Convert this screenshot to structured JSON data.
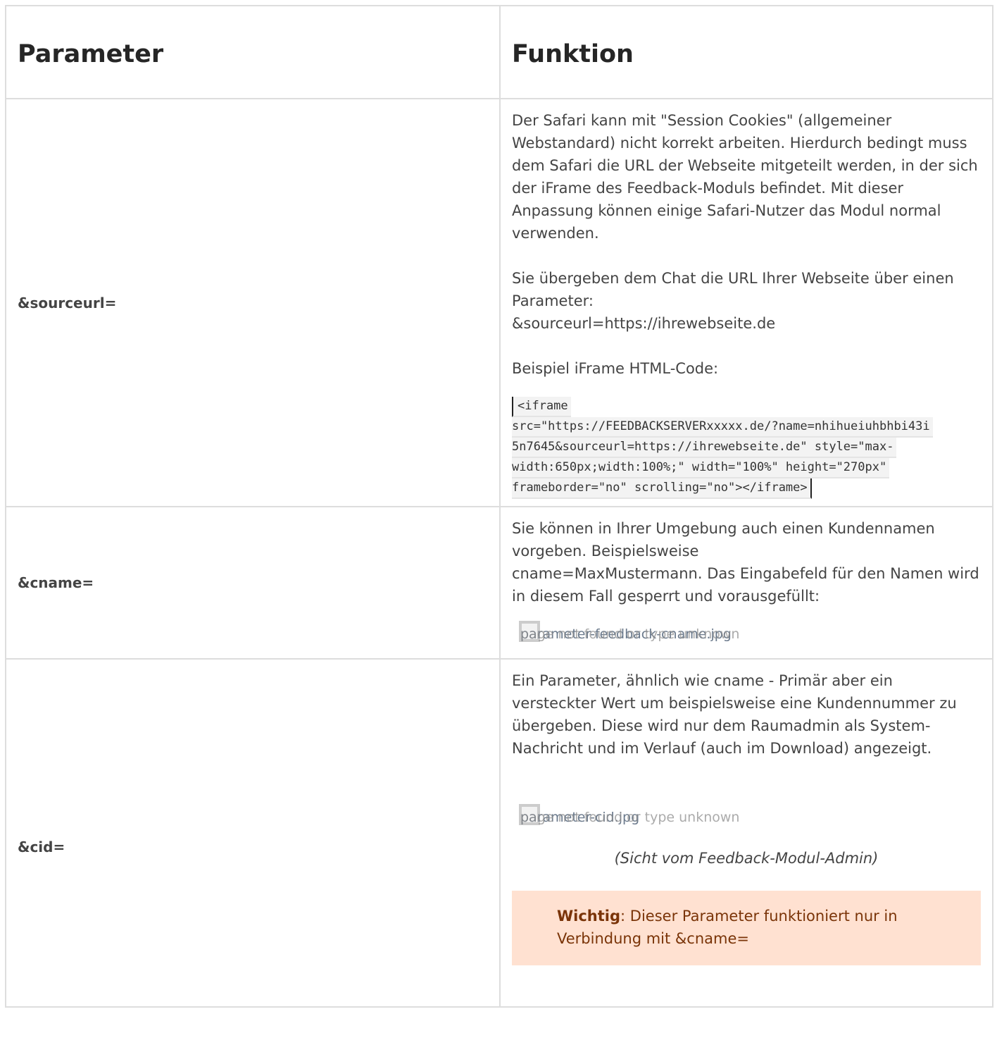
{
  "headers": {
    "parameter": "Parameter",
    "function": "Funktion"
  },
  "rows": [
    {
      "name": "&sourceurl=",
      "para1": "Der Safari kann mit \"Session Cookies\" (allgemeiner Webstandard) nicht korrekt arbeiten. Hierdurch bedingt muss dem Safari die URL der Webseite mitgeteilt werden, in der sich der iFrame des Feedback-Moduls befindet. Mit dieser Anpassung können einige Safari-Nutzer das Modul normal verwenden.",
      "para2_line1": "Sie übergeben dem Chat die URL Ihrer Webseite über einen Parameter:",
      "para2_line2": "&sourceurl=https://ihrewebseite.de",
      "para3": "Beispiel iFrame HTML-Code:",
      "code_lines": [
        "<iframe ",
        "src=\"https://FEEDBACKSERVERxxxxx.de/?name=nhihueiuhbhbi43i",
        "5n7645&sourceurl=https://ihrewebseite.de\" style=\"max-",
        "width:650px;width:100%;\"  width=\"100%\" height=\"270px\"",
        "frameborder=\"no\" scrolling=\"no\"></iframe>"
      ]
    },
    {
      "name": "&cname=",
      "para1": "Sie können in Ihrer Umgebung auch einen Kundennamen vorgeben. Beispielsweise",
      "para2": "cname=MaxMustermann. Das Eingabefeld für den Namen wird in diesem Fall gesperrt und vorausgefüllt:",
      "image_filename": "parameter-feedback-cname.jpg",
      "image_error": "page not found or type unknown"
    },
    {
      "name": "&cid=",
      "para1": "Ein Parameter, ähnlich wie cname - Primär aber ein versteckter Wert um beispielsweise eine Kundennummer zu übergeben. Diese wird nur dem Raumadmin als System-Nachricht und im Verlauf (auch im Download) angezeigt.",
      "image_filename": "parameter-cid.jpg",
      "image_error": "page not found or type unknown",
      "caption": "(Sicht vom Feedback-Modul-Admin)",
      "note_label": "Wichtig",
      "note_text": ": Dieser Parameter funktioniert nur in Verbindung mit &cname="
    }
  ]
}
